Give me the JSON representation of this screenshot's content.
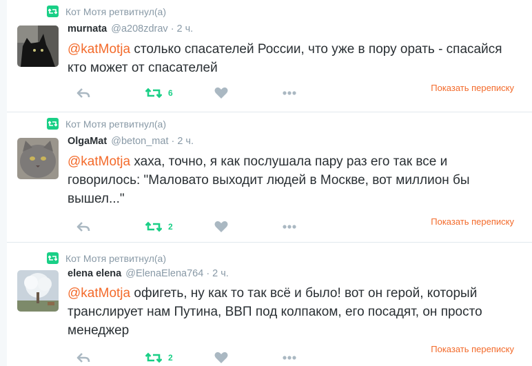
{
  "accent_color": "#f36a2a",
  "retweet_color": "#19cf86",
  "tweets": [
    {
      "retweeted_by": "Кот Мотя ретвитнул(а)",
      "fullname": "murnata",
      "username": "@a208zdrav",
      "separator": "·",
      "time": "2 ч.",
      "mention": "@katMotja",
      "text": " столько спасателей России, что уже в пору орать - спасайся кто может от спасателей",
      "retweet_count": "6",
      "conversation_label": "Показать переписку",
      "avatar": "black-cat-photo"
    },
    {
      "retweeted_by": "Кот Мотя ретвитнул(а)",
      "fullname": "OlgaMat",
      "username": "@beton_mat",
      "separator": "·",
      "time": "2 ч.",
      "mention": "@katMotja",
      "text": " хаха, точно, я как послушала пару раз его так все и говорилось: \"Маловато выходит людей в Москве, вот миллион бы вышел...\"",
      "retweet_count": "2",
      "conversation_label": "Показать переписку",
      "avatar": "grey-cat-photo"
    },
    {
      "retweeted_by": "Кот Мотя ретвитнул(а)",
      "fullname": "elena elena",
      "username": "@ElenaElena764",
      "separator": "·",
      "time": "2 ч.",
      "mention": "@katMotja",
      "text": " офигеть, ну как то так всё и было! вот он герой, который транслирует нам Путина, ВВП под колпаком, его посадят, он просто менеджер",
      "retweet_count": "2",
      "conversation_label": "Показать переписку",
      "avatar": "white-tree-photo"
    }
  ]
}
